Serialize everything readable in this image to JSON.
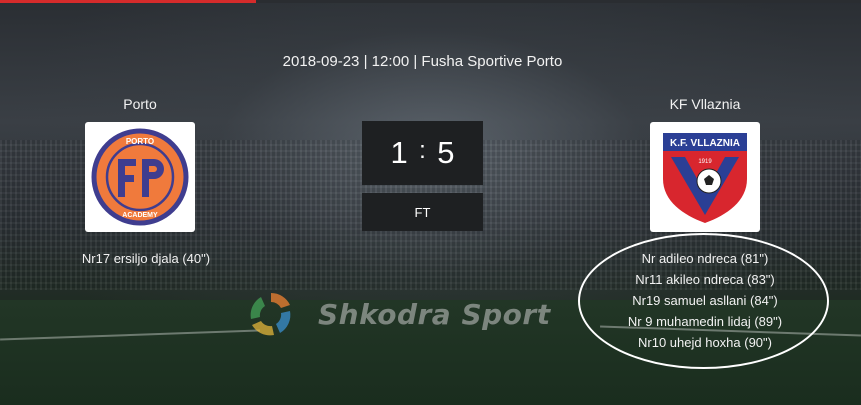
{
  "match": {
    "meta": "2018-09-23 | 12:00 | Fusha Sportive Porto",
    "status": "FT"
  },
  "home": {
    "name": "Porto",
    "score": "1",
    "logo_text_top": "PORTO",
    "logo_text_bottom": "ACADEMY",
    "logo_colors": {
      "fill": "#f07a3c",
      "ring": "#3f3d8f"
    },
    "scorers": [
      "Nr17 ersiljo djala (40\")"
    ]
  },
  "away": {
    "name": "KF Vllaznia",
    "score": "5",
    "logo_text": "K.F. VLLAZNIA",
    "logo_year": "1919",
    "logo_colors": {
      "red": "#d8262e",
      "blue": "#2b3f95"
    },
    "scorers": [
      "Nr adileo ndreca (81\")",
      "Nr11 akileo ndreca (83\")",
      "Nr19 samuel asllani (84\")",
      "Nr 9 muhamedin lidaj (89\")",
      "Nr10 uhejd hoxha (90\")"
    ]
  },
  "watermark": {
    "text": "Shkodra Sport"
  },
  "colors": {
    "accent": "#d52b2b",
    "box": "#1e2022",
    "text": "#f2f2f2"
  }
}
